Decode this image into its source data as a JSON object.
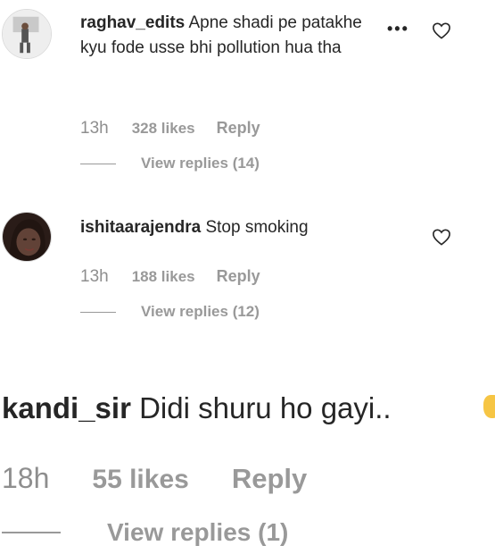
{
  "comments": [
    {
      "username": "raghav_edits",
      "text": "Apne shadi pe patakhe kyu fode usse bhi pollution hua tha⁣",
      "time": "13h",
      "likes": "328 likes",
      "reply": "Reply",
      "view_replies": "View replies (14)",
      "more_icon": "more-options-icon",
      "heart_icon": "heart-outline-icon"
    },
    {
      "username": "ishitaarajendra",
      "text": "Stop smoking",
      "time": "13h",
      "likes": "188 likes",
      "reply": "Reply",
      "view_replies": "View replies (12)",
      "heart_icon": "heart-outline-icon"
    },
    {
      "username": "kandi_sir",
      "text": "Didi shuru ho gayi..",
      "time": "18h",
      "likes": "55 likes",
      "reply": "Reply",
      "view_replies": "View replies (1)"
    }
  ],
  "colors": {
    "text": "#262626",
    "muted": "#999999",
    "background": "#ffffff"
  }
}
